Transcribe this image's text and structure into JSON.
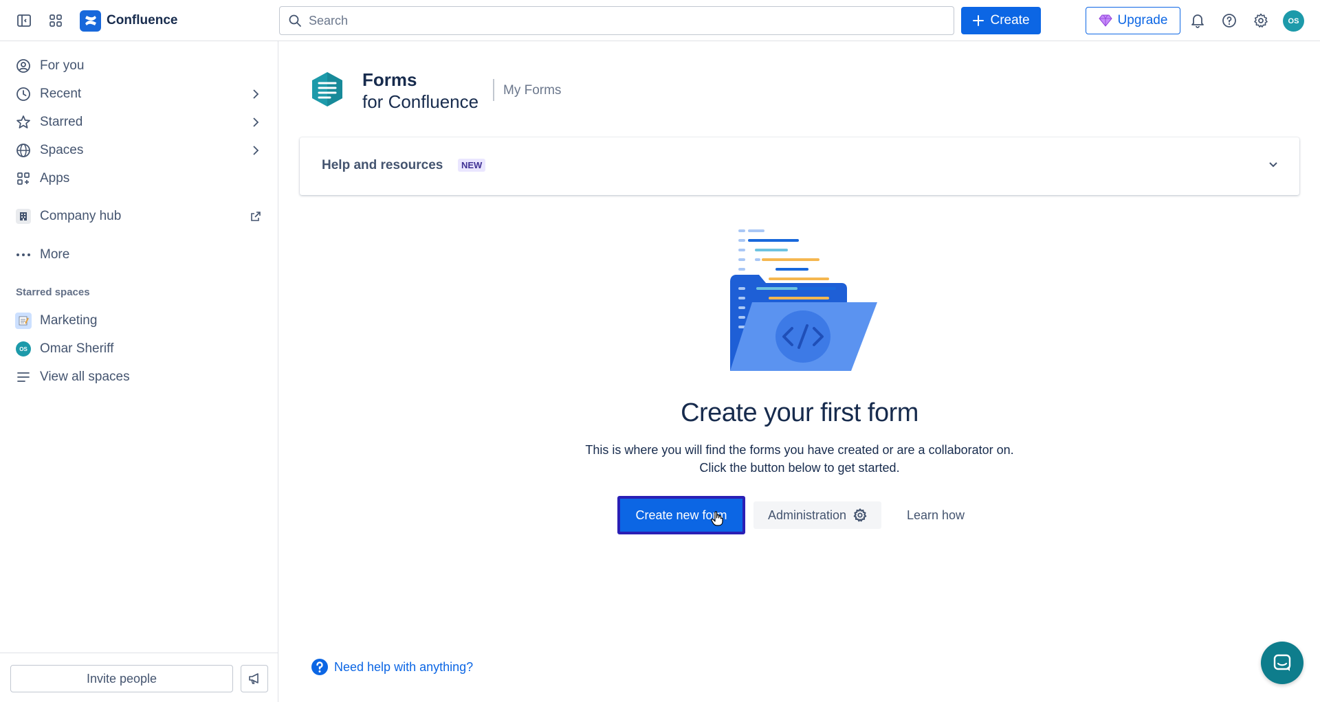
{
  "app": {
    "name": "Confluence"
  },
  "topbar": {
    "search_placeholder": "Search",
    "create_label": "Create",
    "upgrade_label": "Upgrade",
    "avatar_initials": "OS"
  },
  "sidebar": {
    "nav": [
      {
        "label": "For you",
        "icon": "user-circle-icon"
      },
      {
        "label": "Recent",
        "icon": "clock-icon"
      },
      {
        "label": "Starred",
        "icon": "star-icon"
      },
      {
        "label": "Spaces",
        "icon": "globe-icon"
      },
      {
        "label": "Apps",
        "icon": "apps-icon"
      },
      {
        "label": "Company hub",
        "icon": "building-icon"
      },
      {
        "label": "More",
        "icon": "more-icon"
      }
    ],
    "starred_section_label": "Starred spaces",
    "starred_spaces": [
      {
        "label": "Marketing",
        "icon": "memo-emoji-icon"
      },
      {
        "label": "Omar Sheriff",
        "initials": "OS"
      },
      {
        "label": "View all spaces",
        "icon": "list-icon"
      }
    ],
    "invite_label": "Invite people"
  },
  "main": {
    "product_title_line1": "Forms",
    "product_title_line2": "for Confluence",
    "product_subtitle": "My Forms",
    "help_panel": {
      "title": "Help and resources",
      "badge": "NEW"
    },
    "empty_state": {
      "title": "Create your first form",
      "desc_line1": "This is where you will find the forms you have created or are a collaborator on.",
      "desc_line2": "Click the button below to get started."
    },
    "buttons": {
      "create_form": "Create new form",
      "administration": "Administration",
      "learn_how": "Learn how"
    },
    "need_help_label": "Need help with anything?"
  },
  "colors": {
    "brand_blue": "#0c66e4",
    "forms_teal": "#1d9aaa",
    "focus_ring": "#2a1fb5"
  }
}
